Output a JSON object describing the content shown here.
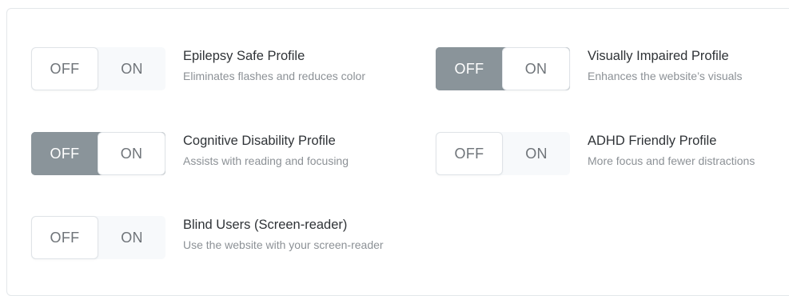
{
  "profiles": [
    {
      "title": "Epilepsy Safe Profile",
      "description": "Eliminates flashes and reduces color",
      "off_label": "OFF",
      "on_label": "ON",
      "state": "unset"
    },
    {
      "title": "Visually Impaired Profile",
      "description": "Enhances the website’s visuals",
      "off_label": "OFF",
      "on_label": "ON",
      "state": "off"
    },
    {
      "title": "Cognitive Disability Profile",
      "description": "Assists with reading and focusing",
      "off_label": "OFF",
      "on_label": "ON",
      "state": "off"
    },
    {
      "title": "ADHD Friendly Profile",
      "description": "More focus and fewer distractions",
      "off_label": "OFF",
      "on_label": "ON",
      "state": "unset"
    },
    {
      "title": "Blind Users (Screen-reader)",
      "description": "Use the website with your screen-reader",
      "off_label": "OFF",
      "on_label": "ON",
      "state": "unset"
    }
  ],
  "colors": {
    "active_off": "#8a949a",
    "title_text": "#2f3337",
    "description_text": "#8c9196",
    "segment_text": "#6f7479"
  }
}
